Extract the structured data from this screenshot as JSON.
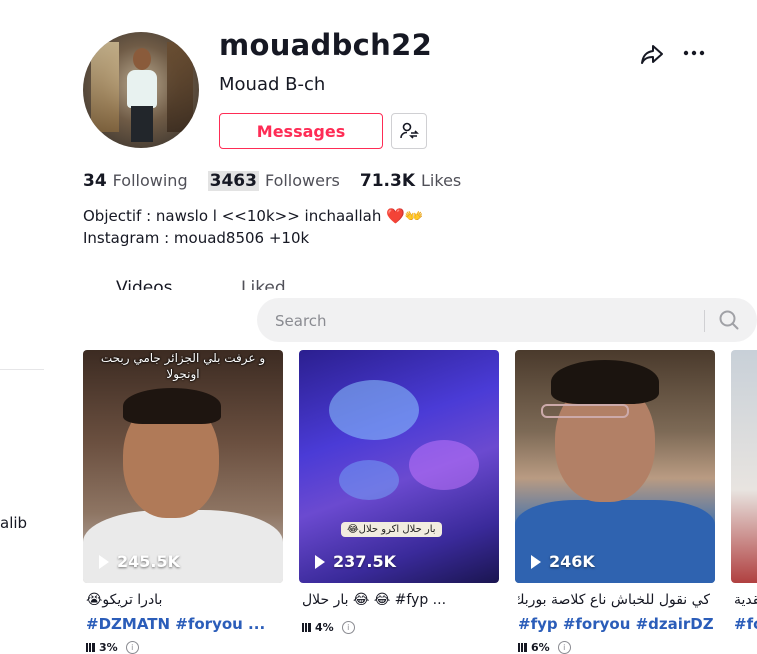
{
  "profile": {
    "username": "mouadbch22",
    "nickname": "Mouad B-ch",
    "messages_label": "Messages",
    "following_count": "34",
    "following_label": "Following",
    "followers_count": "3463",
    "followers_label": "Followers",
    "likes_count": "71.3K",
    "likes_label": "Likes",
    "bio_line1": "Objectif : nawslo l <<10k>> inchaallah",
    "bio_line1_emoji": "❤️👐",
    "bio_line2": "Instagram : mouad8506 +10k"
  },
  "tabs": {
    "videos": "Videos",
    "liked": "Liked"
  },
  "search": {
    "placeholder": "Search"
  },
  "sidebar": {
    "partial_text": "alib"
  },
  "videos": [
    {
      "views": "245.5K",
      "overlay_text": "و عرفت بلي الجزائر جامي ربحت اونجولا",
      "caption": "بادرا تريكو😭",
      "tags": "#DZMATN #foryou ...",
      "metric": "3%"
    },
    {
      "views": "237.5K",
      "overlay_text": "بار حلال اكرو حلال😂",
      "caption": "بار حلال 😂 😂 #fyp ...",
      "tags": "",
      "metric": "4%"
    },
    {
      "views": "246K",
      "overlay_text": "",
      "caption": "كي نقول للخباش ناع كلاصة بوربك...",
      "tags": "#fyp #foryou #dzairDZ ...",
      "metric": "6%"
    },
    {
      "views": "",
      "overlay_text": "",
      "caption": "نقدية",
      "tags": "#fo",
      "metric": ""
    }
  ]
}
